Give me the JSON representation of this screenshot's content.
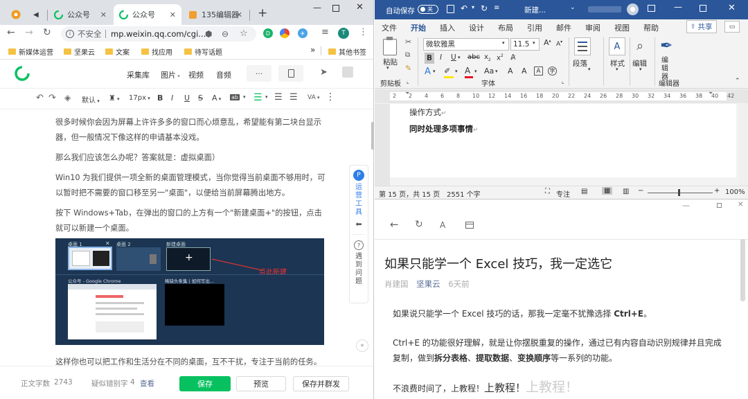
{
  "chrome": {
    "tabs": [
      {
        "label": ""
      },
      {
        "label": "公众号"
      },
      {
        "label": "公众号"
      },
      {
        "label": "135编辑器"
      }
    ],
    "new_tab": "+",
    "omnibox": {
      "security": "不安全",
      "url": "mp.weixin.qq.com/cgi..."
    },
    "profile_initial": "T",
    "bookmarks": [
      "新媒体运营",
      "坚果云",
      "文案",
      "找应用",
      "待写话题"
    ],
    "bookmarks_other": "其他书签",
    "bookmarks_more": "»"
  },
  "editor": {
    "insert_tools": [
      "采集库",
      "图片",
      "视频",
      "音频"
    ],
    "more": "···",
    "format": {
      "style": "默认",
      "size": "17px",
      "bold": "B",
      "italic": "I",
      "underline": "U",
      "strike": "S",
      "fontcolor": "A",
      "bg": "ab",
      "lineheight": "VA"
    },
    "paragraphs": [
      "很多时候你会因为屏幕上许许多多的窗口而心烦意乱，希望能有第二块台显示器，但一般情况下像这样的申请基本没戏。",
      "那么我们应该怎么办呢？答案就是：虚拟桌面）",
      "Win10 为我们提供一项全新的桌面管理模式，当你觉得当前桌面不够用时，可以暂时把不需要的窗口移至另一\"桌面\"，以便给当前屏幕腾出地方。",
      "按下 Windows+Tab，在弹出的窗口的上方有一个\"新建桌面+\"的按钮，点击就可以新建一个桌面。"
    ],
    "after_image": "这样你也可以把工作和生活分在不同的桌面，互不干扰，专注于当前的任务。",
    "screenshot": {
      "desktop1": "桌面 1",
      "desktop2": "桌面 2",
      "new_desktop": "新建桌面",
      "annotation": "点此新建",
      "window1": "公众号 - Google Chrome",
      "window2": "稀缺头条集 | 如何写出...",
      "plus": "+"
    },
    "side_panel": {
      "tool": "运营工具",
      "help": "遇到问题"
    },
    "footer": {
      "word_count_label": "正文字数",
      "word_count": "2743",
      "typo_label": "疑似错别字",
      "typo_count": "4",
      "view": "查看",
      "save": "保存",
      "preview": "预览",
      "save_publish": "保存并群发"
    }
  },
  "word": {
    "autosave_label": "自动保存",
    "autosave_state": "关",
    "doc_title": "新建...",
    "menu": [
      "文件",
      "开始",
      "插入",
      "设计",
      "布局",
      "引用",
      "邮件",
      "审阅",
      "视图",
      "帮助"
    ],
    "share": "共享",
    "font_name": "微软雅黑",
    "font_size": "11.5",
    "groups": {
      "clipboard": "剪贴板",
      "font": "字体",
      "paragraph": "段落",
      "style": "样式",
      "editing": "编辑",
      "editor": "编辑器"
    },
    "paste": "粘贴",
    "ruler": [
      "2",
      "2",
      "4",
      "6",
      "8",
      "10",
      "12",
      "14",
      "16",
      "18",
      "20",
      "22",
      "24",
      "26",
      "28",
      "30",
      "32",
      "34",
      "36",
      "38",
      "40",
      "42"
    ],
    "doc_lines": [
      "操作方式",
      "同时处理多项事情"
    ],
    "status": {
      "page": "第 15 页，共 15 页",
      "words": "2551 个字",
      "focus": "专注",
      "zoom": "100%"
    }
  },
  "reader": {
    "title": "如果只能学一个 Excel 技巧，我一定选它",
    "author": "肖建国",
    "source": "坚果云",
    "time": "6天前",
    "p1_pre": "如果说只能学一个 Excel 技巧的话，那我一定毫不犹豫选择 ",
    "p1_bold": "Ctrl+E",
    "p1_post": "。",
    "p2_pre": "Ctrl+E 的功能很好理解，就是让你摆脱重复的操作，通过已有内容自动识别规律并且完成复制，做到",
    "p2_b1": "拆分表格",
    "p2_s1": "、",
    "p2_b2": "提取数据",
    "p2_s2": "、",
    "p2_b3": "变换顺序",
    "p2_post": "等一系列的功能。",
    "p3_a": "不浪费时间了，上教程！",
    "p3_b": "上教程！",
    "p3_c": "上教程！"
  }
}
